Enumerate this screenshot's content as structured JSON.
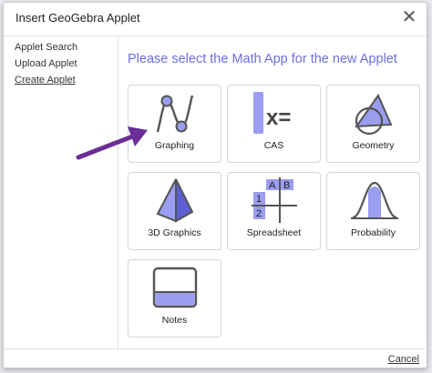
{
  "dialog": {
    "title": "Insert GeoGebra Applet",
    "close_glyph": "✕"
  },
  "sidebar": {
    "items": [
      {
        "label": "Applet Search"
      },
      {
        "label": "Upload Applet"
      },
      {
        "label": "Create Applet"
      }
    ]
  },
  "main": {
    "heading": "Please select the Math App for the new Applet",
    "apps": [
      {
        "label": "Graphing",
        "icon": "graphing-icon"
      },
      {
        "label": "CAS",
        "icon": "cas-icon",
        "glyph": "x="
      },
      {
        "label": "Geometry",
        "icon": "geometry-icon"
      },
      {
        "label": "3D Graphics",
        "icon": "3d-graphics-icon"
      },
      {
        "label": "Spreadsheet",
        "icon": "spreadsheet-icon",
        "cells": [
          "A",
          "B",
          "1",
          "2"
        ]
      },
      {
        "label": "Probability",
        "icon": "probability-icon"
      },
      {
        "label": "Notes",
        "icon": "notes-icon"
      }
    ]
  },
  "footer": {
    "cancel_label": "Cancel"
  },
  "colors": {
    "accent": "#6b6fe0",
    "icon_fill": "#9a9df0",
    "icon_stroke": "#555555",
    "arrow": "#6a2e97"
  }
}
